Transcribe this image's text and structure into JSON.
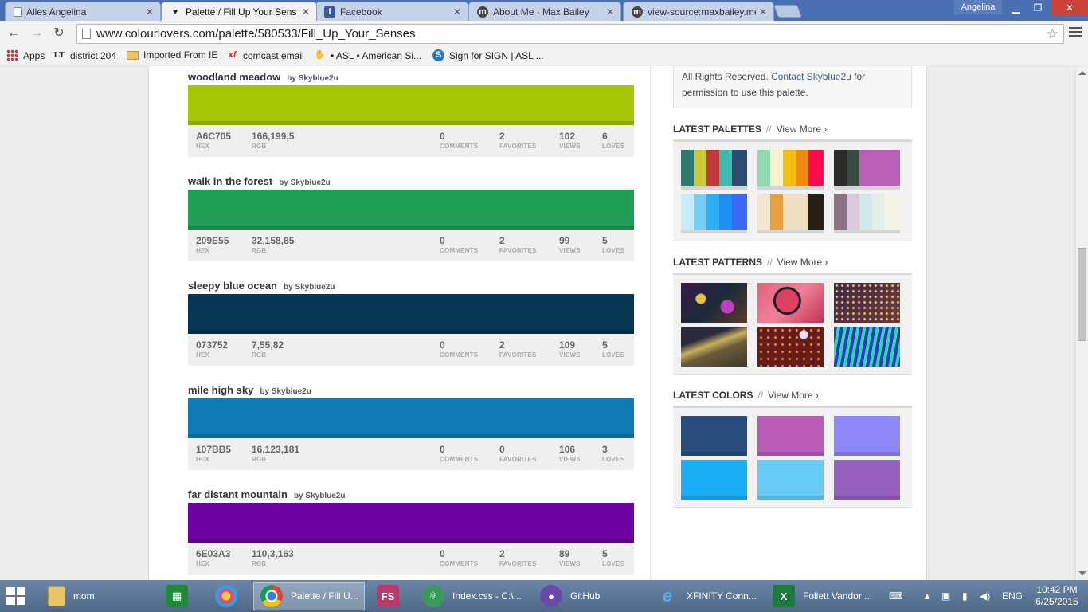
{
  "browser": {
    "tabs": [
      {
        "label": "Alles Angelina",
        "icon": "page-icon"
      },
      {
        "label": "Palette / Fill Up Your Sens",
        "icon": "colourlovers-heart-icon"
      },
      {
        "label": "Facebook",
        "icon": "facebook-icon"
      },
      {
        "label": "About Me · Max Bailey",
        "icon": "m-site-icon"
      },
      {
        "label": "view-source:maxbailey.me",
        "icon": "m-site-icon"
      }
    ],
    "user": "Angelina",
    "url": "www.colourlovers.com/palette/580533/Fill_Up_Your_Senses"
  },
  "bookmarks": [
    {
      "label": "Apps",
      "icon": "apps-grid-icon"
    },
    {
      "label": "district 204",
      "icon": "lt-icon"
    },
    {
      "label": "Imported From IE",
      "icon": "folder-icon"
    },
    {
      "label": "comcast email",
      "icon": "xf-icon"
    },
    {
      "label": "• ASL • American Si...",
      "icon": "asl-icon"
    },
    {
      "label": "Sign for SIGN | ASL ...",
      "icon": "sign-icon"
    }
  ],
  "colors": [
    {
      "name": "woodland meadow",
      "by": "by",
      "author": "Skyblue2u",
      "swatch": "#A6C705",
      "hex": "A6C705",
      "rgb": "166,199,5",
      "comments": "0",
      "favorites": "2",
      "views": "102",
      "loves": "6"
    },
    {
      "name": "walk in the forest",
      "by": "by",
      "author": "Skyblue2u",
      "swatch": "#209E55",
      "hex": "209E55",
      "rgb": "32,158,85",
      "comments": "0",
      "favorites": "2",
      "views": "99",
      "loves": "5"
    },
    {
      "name": "sleepy blue ocean",
      "by": "by",
      "author": "Skyblue2u",
      "swatch": "#073752",
      "hex": "073752",
      "rgb": "7,55,82",
      "comments": "0",
      "favorites": "2",
      "views": "109",
      "loves": "5"
    },
    {
      "name": "mile high sky",
      "by": "by",
      "author": "Skyblue2u",
      "swatch": "#107BB5",
      "hex": "107BB5",
      "rgb": "16,123,181",
      "comments": "0",
      "favorites": "0",
      "views": "106",
      "loves": "3"
    },
    {
      "name": "far distant mountain",
      "by": "by",
      "author": "Skyblue2u",
      "swatch": "#6E03A3",
      "hex": "6E03A3",
      "rgb": "110,3,163",
      "comments": "0",
      "favorites": "2",
      "views": "89",
      "loves": "5"
    }
  ],
  "stat_labels": {
    "hex": "HEX",
    "rgb": "RGB",
    "comments": "COMMENTS",
    "favorites": "FAVORITES",
    "views": "VIEWS",
    "loves": "LOVES"
  },
  "sidebar": {
    "rights_text_1": "All Rights Reserved.",
    "rights_link": "Contact Skyblue2u",
    "rights_text_2": "for permission to use this palette.",
    "view_more": "View More ›",
    "latest_palettes_title": "LATEST PALETTES",
    "latest_patterns_title": "LATEST PATTERNS",
    "latest_colors_title": "LATEST COLORS",
    "palettes": [
      [
        "#2a7a6e",
        "#c9c93a",
        "#c0393b",
        "#3fb8ae",
        "#2c4a72"
      ],
      [
        "#94d9b0",
        "#f7f3d0",
        "#f2c00f",
        "#f28a0f",
        "#ff0a4f"
      ],
      [
        "#2a2a28",
        "#3a4a40",
        "#b85eb5",
        "#b85eb5",
        "#b85eb5"
      ],
      [
        "#c8eefa",
        "#77cdf5",
        "#2cb0f0",
        "#1f8ef0",
        "#3a6af5"
      ],
      [
        "#f3e6cc",
        "#e8a040",
        "#efdfc2",
        "#efdfc2",
        "#2a1f18"
      ],
      [
        "#8f7382",
        "#d9c9dc",
        "#d0e8ec",
        "#e6eee8",
        "#f4f3e6"
      ]
    ],
    "latest_colors": [
      "#284C7C",
      "#B85CB5",
      "#8F87F7",
      "#1BAEF5",
      "#68CCF7",
      "#9560BE"
    ]
  },
  "taskbar": {
    "items": [
      {
        "label": "mom",
        "icon": "folder-icon"
      },
      {
        "label": "",
        "icon": "store-icon"
      },
      {
        "label": "",
        "icon": "picture-viewer-icon"
      },
      {
        "label": "Palette / Fill U...",
        "icon": "chrome-icon"
      },
      {
        "label": "",
        "icon": "fs-icon"
      },
      {
        "label": "Index.css - C:\\...",
        "icon": "atom-icon"
      },
      {
        "label": "GitHub",
        "icon": "github-icon"
      },
      {
        "label": "XFINITY Conn...",
        "icon": "ie-icon"
      },
      {
        "label": "Follett Vandor ...",
        "icon": "excel-icon"
      }
    ],
    "language": "ENG",
    "time": "10:42 PM",
    "date": "6/25/2015"
  }
}
